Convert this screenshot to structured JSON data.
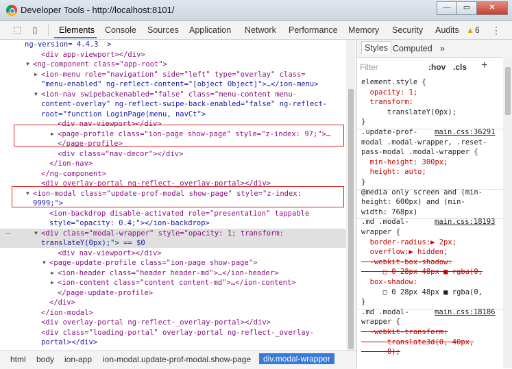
{
  "window": {
    "title": "Developer Tools - http://localhost:8101/",
    "minimize": "—",
    "maximize": "▭",
    "close": "✕"
  },
  "tabs": [
    "Elements",
    "Console",
    "Sources",
    "Application",
    "Network",
    "Performance",
    "Memory",
    "Security",
    "Audits"
  ],
  "warnings": {
    "count": "6"
  },
  "dom_lines": [
    {
      "indent": 3,
      "arrow": "",
      "text": "ng-version= 4.4.3  >"
    },
    {
      "indent": 5,
      "arrow": "",
      "text": "<div app-viewport></div>"
    },
    {
      "indent": 4,
      "arrow": "▼",
      "text": "<ng-component class=\"app-root\">"
    },
    {
      "indent": 5,
      "arrow": "▶",
      "text": "<ion-menu role=\"navigation\" side=\"left\" type=\"overlay\" class="
    },
    {
      "indent": 5,
      "arrow": "",
      "text": "\"menu-enabled\" ng-reflect-content=\"[object Object]\">…</ion-menu>"
    },
    {
      "indent": 5,
      "arrow": "▼",
      "text": "<ion-nav swipebackenabled=\"false\" class=\"menu-content menu-"
    },
    {
      "indent": 5,
      "arrow": "",
      "text": "content-overlay\" ng-reflect-swipe-back-enabled=\"false\" ng-reflect-"
    },
    {
      "indent": 5,
      "arrow": "",
      "text": "root=\"function LoginPage(menu, navCt\">"
    },
    {
      "indent": 7,
      "arrow": "",
      "text": "<div nav-viewport></div>"
    },
    {
      "indent": 7,
      "arrow": "▶",
      "text": "<page-profile class=\"ion-page show-page\" style=\"z-index: 97;\">…"
    },
    {
      "indent": 7,
      "arrow": "",
      "text": "</page-profile>"
    },
    {
      "indent": 7,
      "arrow": "",
      "text": "<div class=\"nav-decor\"></div>"
    },
    {
      "indent": 6,
      "arrow": "",
      "text": "</ion-nav>"
    },
    {
      "indent": 5,
      "arrow": "",
      "text": "</ng-component>"
    },
    {
      "indent": 5,
      "arrow": "",
      "text": "<div overlay-portal ng-reflect-_overlay-portal></div>"
    },
    {
      "indent": 4,
      "arrow": "▼",
      "text": "<ion-modal class=\"update-prof-modal show-page\" style=\"z-index:"
    },
    {
      "indent": 4,
      "arrow": "",
      "text": "9999;\">"
    },
    {
      "indent": 6,
      "arrow": "",
      "text": "<ion-backdrop disable-activated role=\"presentation\" tappable"
    },
    {
      "indent": 6,
      "arrow": "",
      "text": "style=\"opacity: 0.4;\"></ion-backdrop>"
    },
    {
      "indent": 5,
      "arrow": "▼",
      "text": "<div class=\"modal-wrapper\" style=\"opacity: 1; transform:"
    },
    {
      "indent": 5,
      "arrow": "",
      "text": "translateY(0px);\"> == $0"
    },
    {
      "indent": 7,
      "arrow": "",
      "text": "<div nav-viewport></div>"
    },
    {
      "indent": 6,
      "arrow": "▼",
      "text": "<page-update-profile class=\"ion-page show-page\">"
    },
    {
      "indent": 7,
      "arrow": "▶",
      "text": "<ion-header class=\"header header-md\">…</ion-header>"
    },
    {
      "indent": 7,
      "arrow": "▶",
      "text": "<ion-content class=\"content content-md\">…</ion-content>"
    },
    {
      "indent": 7,
      "arrow": "",
      "text": "</page-update-profile>"
    },
    {
      "indent": 6,
      "arrow": "",
      "text": "</div>"
    },
    {
      "indent": 5,
      "arrow": "",
      "text": "</ion-modal>"
    },
    {
      "indent": 5,
      "arrow": "",
      "text": "<div overlay-portal ng-reflect-_overlay-portal></div>"
    },
    {
      "indent": 5,
      "arrow": "",
      "text": "<div class=\"loading-portal\" overlay-portal ng-reflect-_overlay-"
    },
    {
      "indent": 5,
      "arrow": "",
      "text": "portal></div>"
    }
  ],
  "breadcrumbs": [
    "html",
    "body",
    "ion-app",
    "ion-modal.update-prof-modal.show-page",
    "div.modal-wrapper"
  ],
  "styles": {
    "tabs": [
      "Styles",
      "Computed"
    ],
    "more": "»",
    "filter_placeholder": "Filter",
    "hov": ":hov",
    "cls": ".cls",
    "add": "+",
    "rules": [
      {
        "text": "element.style {",
        "kind": "sel"
      },
      {
        "text": "  opacity: 1;",
        "kind": "prop"
      },
      {
        "text": "  transform:",
        "kind": "prop"
      },
      {
        "text": "      translateY(0px);",
        "kind": "val"
      },
      {
        "text": "}",
        "kind": "sel"
      },
      {
        "text": ".update-prof-",
        "kind": "sel",
        "src": "main.css:36291"
      },
      {
        "text": "modal .modal-wrapper, .reset-",
        "kind": "sel"
      },
      {
        "text": "pass-modal .modal-wrapper {",
        "kind": "sel"
      },
      {
        "text": "  min-height: 300px;",
        "kind": "prop"
      },
      {
        "text": "  height: auto;",
        "kind": "prop"
      },
      {
        "text": "}",
        "kind": "sel"
      },
      {
        "text": "@media only screen and (min-",
        "kind": "sel"
      },
      {
        "text": "height: 600px) and (min-",
        "kind": "sel"
      },
      {
        "text": "width: 768px)",
        "kind": "sel"
      },
      {
        "text": ".md .modal-",
        "kind": "sel",
        "src": "main.css:18193"
      },
      {
        "text": "wrapper {",
        "kind": "sel"
      },
      {
        "text": "  border-radius:▶ 2px;",
        "kind": "prop"
      },
      {
        "text": "  overflow:▶ hidden;",
        "kind": "prop"
      },
      {
        "text": "  -webkit-box-shadow:",
        "kind": "strike"
      },
      {
        "text": "     ▢ 0 28px 48px ■ rgba(0,",
        "kind": "valstrike"
      },
      {
        "text": "  box-shadow:",
        "kind": "prop"
      },
      {
        "text": "     ▢ 0 28px 48px ■ rgba(0,",
        "kind": "val"
      },
      {
        "text": "}",
        "kind": "sel"
      },
      {
        "text": ".md .modal-",
        "kind": "sel",
        "src": "main.css:18186"
      },
      {
        "text": "wrapper {",
        "kind": "sel"
      },
      {
        "text": "  -webkit-transform:",
        "kind": "strike"
      },
      {
        "text": "      translate3d(0, 40px,",
        "kind": "valstrike"
      },
      {
        "text": "      0);",
        "kind": "valstrike"
      }
    ]
  },
  "accent": "#3879d9"
}
